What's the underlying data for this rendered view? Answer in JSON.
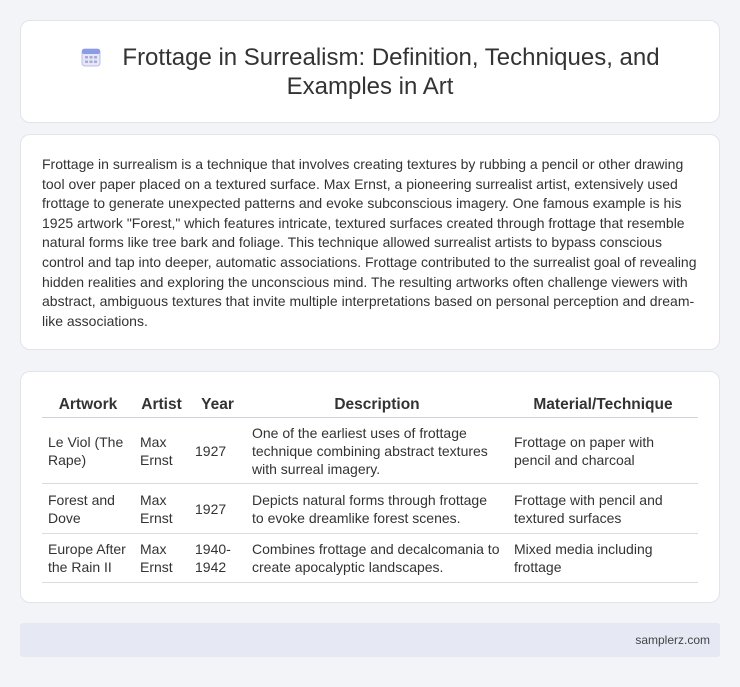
{
  "header": {
    "icon": "calendar-icon",
    "title_line1": "Frottage in Surrealism: Definition, Techniques, and",
    "title_line2": "Examples in Art"
  },
  "intro": {
    "text": "Frottage in surrealism is a technique that involves creating textures by rubbing a pencil or other drawing tool over paper placed on a textured surface. Max Ernst, a pioneering surrealist artist, extensively used frottage to generate unexpected patterns and evoke subconscious imagery. One famous example is his 1925 artwork \"Forest,\" which features intricate, textured surfaces created through frottage that resemble natural forms like tree bark and foliage. This technique allowed surrealist artists to bypass conscious control and tap into deeper, automatic associations. Frottage contributed to the surrealist goal of revealing hidden realities and exploring the unconscious mind. The resulting artworks often challenge viewers with abstract, ambiguous textures that invite multiple interpretations based on personal perception and dream-like associations."
  },
  "table": {
    "headers": [
      "Artwork",
      "Artist",
      "Year",
      "Description",
      "Material/Technique"
    ],
    "rows": [
      [
        "Le Viol (The Rape)",
        "Max Ernst",
        "1927",
        "One of the earliest uses of frottage technique combining abstract textures with surreal imagery.",
        "Frottage on paper with pencil and charcoal"
      ],
      [
        "Forest and Dove",
        "Max Ernst",
        "1927",
        "Depicts natural forms through frottage to evoke dreamlike forest scenes.",
        "Frottage with pencil and textured surfaces"
      ],
      [
        "Europe After the Rain II",
        "Max Ernst",
        "1940-1942",
        "Combines frottage and decalcomania to create apocalyptic landscapes.",
        "Mixed media including frottage"
      ]
    ]
  },
  "footer": {
    "site": "samplerz.com"
  },
  "colors": {
    "background": "#f3f4f8",
    "card": "#ffffff",
    "footer": "#e6e9f4",
    "icon_accent": "#7b8fe0"
  }
}
